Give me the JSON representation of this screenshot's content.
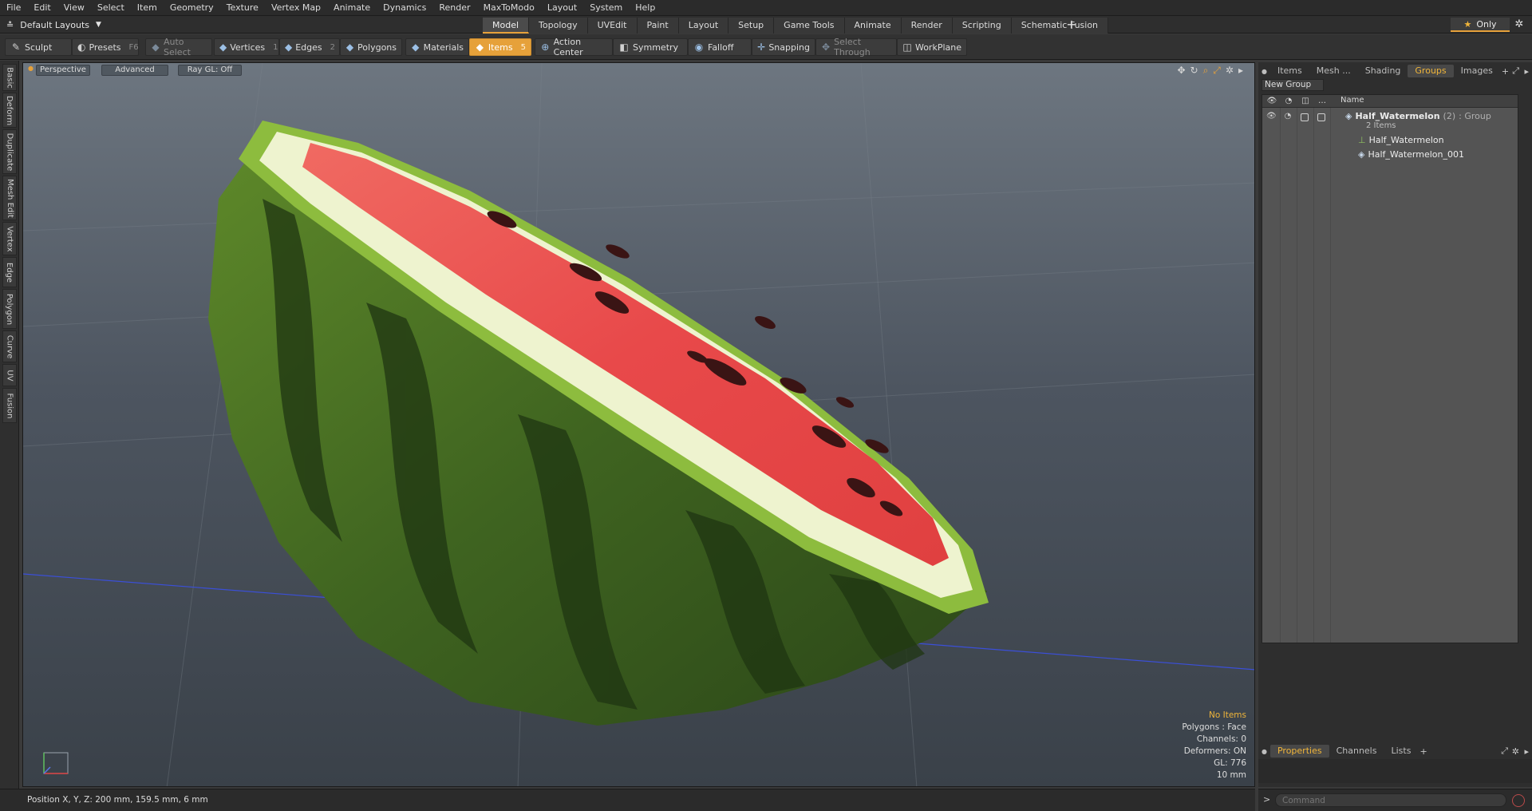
{
  "menu": [
    "File",
    "Edit",
    "View",
    "Select",
    "Item",
    "Geometry",
    "Texture",
    "Vertex Map",
    "Animate",
    "Dynamics",
    "Render",
    "MaxToModo",
    "Layout",
    "System",
    "Help"
  ],
  "layout_selector": "Default Layouts",
  "layout_tabs": [
    "Model",
    "Topology",
    "UVEdit",
    "Paint",
    "Layout",
    "Setup",
    "Game Tools",
    "Animate",
    "Render",
    "Scripting",
    "Schematic Fusion"
  ],
  "active_layout_tab": "Model",
  "only_button": "Only",
  "toolbar": {
    "sculpt": "Sculpt",
    "presets": "Presets",
    "presets_key": "F6",
    "auto_select": "Auto Select",
    "vertices": "Vertices",
    "vertices_key": "1",
    "edges": "Edges",
    "edges_key": "2",
    "polygons": "Polygons",
    "materials": "Materials",
    "items": "Items",
    "items_key": "5",
    "action_center": "Action Center",
    "symmetry": "Symmetry",
    "falloff": "Falloff",
    "snapping": "Snapping",
    "select_through": "Select Through",
    "workplane": "WorkPlane"
  },
  "left_tabs": [
    "Basic",
    "Deform",
    "Duplicate",
    "Mesh Edit",
    "Vertex",
    "Edge",
    "Polygon",
    "Curve",
    "UV",
    "Fusion"
  ],
  "viewport": {
    "view_mode": "Perspective",
    "shading": "Advanced",
    "raygl": "Ray GL: Off",
    "stats": {
      "no_items": "No Items",
      "polygons": "Polygons : Face",
      "channels": "Channels: 0",
      "deformers": "Deformers: ON",
      "gl": "GL: 776",
      "grid": "10 mm"
    }
  },
  "right_panel": {
    "tabs": [
      "Items",
      "Mesh ...",
      "Shading",
      "Groups",
      "Images"
    ],
    "active_tab": "Groups",
    "new_group": "New Group",
    "name_column": "Name",
    "group": {
      "name": "Half_Watermelon",
      "count": "(2)",
      "type": ": Group",
      "sub": "2 Items",
      "children": [
        "Half_Watermelon",
        "Half_Watermelon_001"
      ]
    }
  },
  "properties_tabs": [
    "Properties",
    "Channels",
    "Lists"
  ],
  "active_properties_tab": "Properties",
  "status": {
    "position": "Position X, Y, Z:  200 mm, 159.5 mm, 6 mm"
  },
  "command_placeholder": "Command",
  "colors": {
    "accent": "#e6a13a",
    "rind_dark": "#2f4a1a",
    "rind_light": "#7fae38",
    "flesh": "#e8494a",
    "pith": "#f4f7dc"
  }
}
